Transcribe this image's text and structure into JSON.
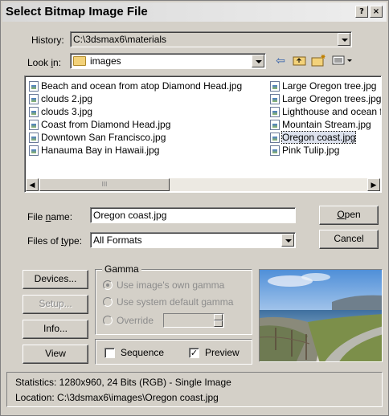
{
  "window": {
    "title": "Select Bitmap Image File"
  },
  "history": {
    "label": "History:",
    "value": "C:\\3dsmax6\\materials"
  },
  "look_in": {
    "label": "Look in:",
    "value": "images"
  },
  "files": {
    "left": [
      "Beach and ocean from atop Diamond Head.jpg",
      "clouds 2.jpg",
      "clouds 3.jpg",
      "Coast from Diamond Head.jpg",
      "Downtown San Francisco.jpg",
      "Hanauma Bay in Hawaii.jpg"
    ],
    "right": [
      "Large Oregon tree.jpg",
      "Large Oregon trees.jpg",
      "Lighthouse and ocean f",
      "Mountain Stream.jpg",
      "Oregon coast.jpg",
      "Pink Tulip.jpg"
    ],
    "selected": "Oregon coast.jpg"
  },
  "file_name": {
    "label": "File name:",
    "value": "Oregon coast.jpg"
  },
  "files_of_type": {
    "label": "Files of type:",
    "value": "All Formats"
  },
  "buttons": {
    "open": "Open",
    "cancel": "Cancel",
    "devices": "Devices...",
    "setup": "Setup...",
    "info": "Info...",
    "view": "View"
  },
  "gamma": {
    "title": "Gamma",
    "opt1": "Use image's own gamma",
    "opt2": "Use system default gamma",
    "opt3": "Override"
  },
  "checkboxes": {
    "sequence": "Sequence",
    "sequence_checked": false,
    "preview": "Preview",
    "preview_checked": true
  },
  "status": {
    "statistics": "Statistics:  1280x960, 24 Bits (RGB) - Single Image",
    "location": "Location:  C:\\3dsmax6\\images\\Oregon coast.jpg"
  },
  "icons": {
    "back": "back-arrow-icon",
    "up": "up-folder-icon",
    "new": "new-folder-icon",
    "view_menu": "view-menu-icon",
    "help": "help-icon",
    "close": "close-icon"
  },
  "colors": {
    "dialog": "#d4d0c8",
    "selection": "#dde2ee"
  }
}
